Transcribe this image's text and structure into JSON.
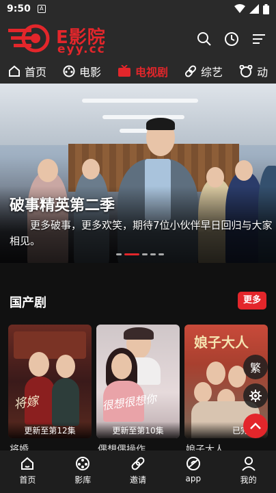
{
  "status_bar": {
    "time": "9:50",
    "notif_glyph": "A"
  },
  "header": {
    "brand": "E影院",
    "domain": "eyy.cc"
  },
  "tabs": [
    {
      "label": "首页",
      "icon": "home-icon"
    },
    {
      "label": "电影",
      "icon": "film-reel-icon"
    },
    {
      "label": "电视剧",
      "icon": "tv-icon",
      "active": true
    },
    {
      "label": "综艺",
      "icon": "link-icon"
    },
    {
      "label": "动",
      "icon": "cartoon-face-icon"
    }
  ],
  "banner": {
    "title": "破事精英第二季",
    "description": "更多破事，更多欢笑，期待7位小伙伴早日回归与大家相见。",
    "slides": 5,
    "active_slide": 1
  },
  "section": {
    "title": "国产剧",
    "more_label": "更多"
  },
  "cards": [
    {
      "badge": "更新至第12集",
      "title": "将婚",
      "poster_text": "将嫁"
    },
    {
      "badge": "更新至第10集",
      "title": "偶想偶操作",
      "poster_text": "很想很想你"
    },
    {
      "badge": "已完",
      "title": "娘子大人",
      "poster_text": "娘子大人"
    }
  ],
  "floating": {
    "traditional_label": "繁"
  },
  "bottom_nav": [
    {
      "label": "首页",
      "icon": "home-icon"
    },
    {
      "label": "影库",
      "icon": "film-reel-icon"
    },
    {
      "label": "邀请",
      "icon": "link-icon"
    },
    {
      "label": "app",
      "icon": "app-icon"
    },
    {
      "label": "我的",
      "icon": "user-icon"
    }
  ],
  "colors": {
    "accent": "#e3262b",
    "header_bg": "#2a2a2a",
    "page_bg": "#111111"
  }
}
